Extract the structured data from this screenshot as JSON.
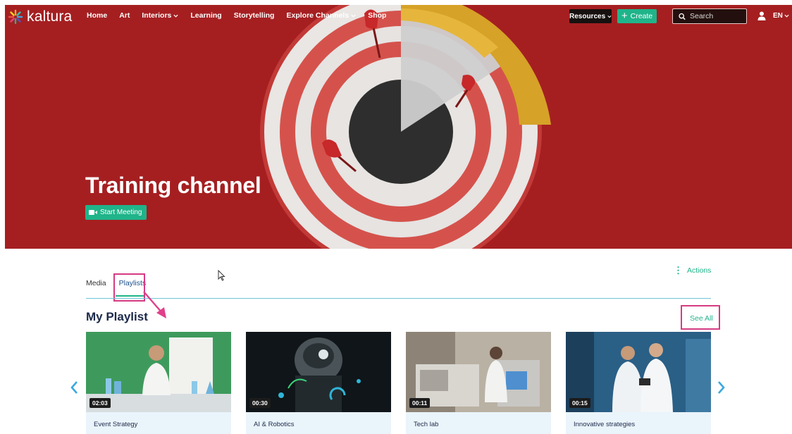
{
  "brand": {
    "name": "kaltura"
  },
  "nav": {
    "items": [
      {
        "label": "Home",
        "dropdown": false
      },
      {
        "label": "Art",
        "dropdown": false
      },
      {
        "label": "Interiors",
        "dropdown": true
      },
      {
        "label": "Learning",
        "dropdown": false
      },
      {
        "label": "Storytelling",
        "dropdown": false
      },
      {
        "label": "Explore Channels",
        "dropdown": true
      },
      {
        "label": "Shop",
        "dropdown": false
      }
    ],
    "resources_label": "Resources",
    "create_label": "Create",
    "search_placeholder": "Search",
    "language": "EN"
  },
  "hero": {
    "title": "Training channel",
    "meeting_label": "Start Meeting"
  },
  "tabs": [
    {
      "label": "Media",
      "active": false
    },
    {
      "label": "Playlists",
      "active": true
    }
  ],
  "actions_label": "Actions",
  "playlist": {
    "title": "My Playlist",
    "see_all": "See All",
    "items": [
      {
        "title": "Event Strategy",
        "duration": "02:03",
        "icon": "lab-presenter"
      },
      {
        "title": "AI & Robotics",
        "duration": "00:30",
        "icon": "robot"
      },
      {
        "title": "Tech lab",
        "duration": "00:11",
        "icon": "lab-machine"
      },
      {
        "title": "Innovative strategies",
        "duration": "00:15",
        "icon": "scientists"
      }
    ]
  },
  "colors": {
    "accent": "#1fb48a",
    "hero_red": "#a81f22",
    "annotation": "#d63b83",
    "title_navy": "#1b2a4a"
  }
}
